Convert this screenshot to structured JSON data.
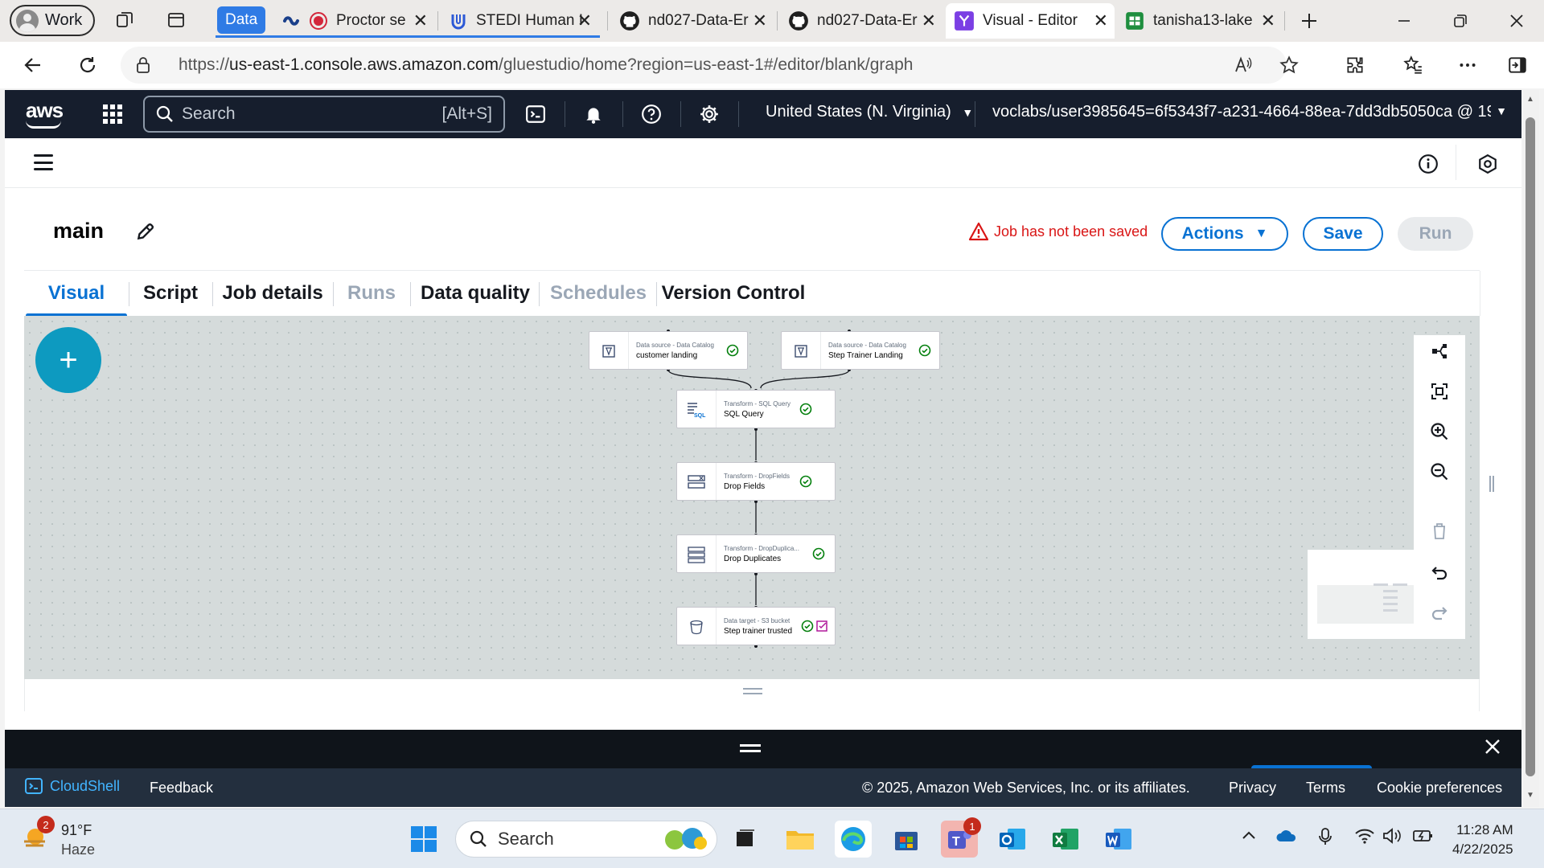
{
  "browser": {
    "profile_label": "Work",
    "tab_group_label": "Data",
    "tabs": [
      {
        "label": "Proctor se"
      },
      {
        "label": "STEDI Human I"
      },
      {
        "label": "nd027-Data-Er"
      },
      {
        "label": "nd027-Data-Er"
      },
      {
        "label": "Visual - Editor"
      },
      {
        "label": "tanisha13-lake"
      }
    ],
    "url_prefix": "https://",
    "url_host": "us-east-1.console.aws.amazon.com",
    "url_path": "/gluestudio/home?region=us-east-1#/editor/blank/graph"
  },
  "aws_header": {
    "logo": "aws",
    "search_placeholder": "Search",
    "search_shortcut": "[Alt+S]",
    "region": "United States (N. Virginia)",
    "account": "voclabs/user3985645=6f5343f7-a231-4664-88ea-7dd3db5050ca @ 19..."
  },
  "job": {
    "name": "main",
    "unsaved_message": "Job has not been saved",
    "actions_label": "Actions",
    "save_label": "Save",
    "run_label": "Run"
  },
  "tabs": [
    {
      "label": "Visual"
    },
    {
      "label": "Script"
    },
    {
      "label": "Job details"
    },
    {
      "label": "Runs"
    },
    {
      "label": "Data quality"
    },
    {
      "label": "Schedules"
    },
    {
      "label": "Version Control"
    }
  ],
  "add_button_label": "+",
  "nodes": [
    {
      "type": "Data source - Data Catalog",
      "name": "customer landing"
    },
    {
      "type": "Data source - Data Catalog",
      "name": "Step Trainer Landing"
    },
    {
      "type": "Transform - SQL Query",
      "name": "SQL Query"
    },
    {
      "type": "Transform - DropFields",
      "name": "Drop Fields"
    },
    {
      "type": "Transform - DropDuplica...",
      "name": "Drop Duplicates"
    },
    {
      "type": "Data target - S3 bucket",
      "name": "Step trainer trusted"
    }
  ],
  "sql_icon_text": "SQL",
  "footer": {
    "cloudshell": "CloudShell",
    "feedback": "Feedback",
    "copyright": "© 2025, Amazon Web Services, Inc. or its affiliates.",
    "privacy": "Privacy",
    "terms": "Terms",
    "cookies": "Cookie preferences"
  },
  "taskbar": {
    "weather_temp": "91°F",
    "weather_desc": "Haze",
    "weather_badge": "2",
    "search_placeholder": "Search",
    "teams_badge": "1",
    "time": "11:28 AM",
    "date": "4/22/2025"
  },
  "colors": {
    "aws_header": "#161e2d",
    "primary_blue": "#0972d3",
    "error_red": "#d91515",
    "success_green": "#037f0c",
    "fab": "#0d9ac0"
  }
}
